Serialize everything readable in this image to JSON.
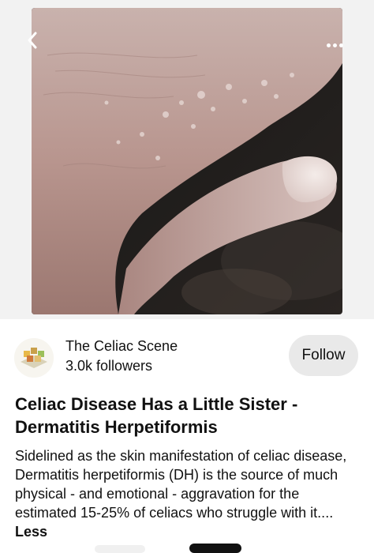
{
  "header": {
    "back_icon": "chevron-left-icon",
    "more_icon": "more-horizontal-icon"
  },
  "creator": {
    "name": "The Celiac Scene",
    "followers": "3.0k followers",
    "follow_label": "Follow"
  },
  "pin": {
    "title": "Celiac Disease Has a Little Sister - Dermatitis Herpetiformis",
    "description": "Sidelined as the skin manifestation of celiac disease, Dermatitis herpetiformis (DH) is the source of much physical - and emotional - aggravation for the estimated 15-25% of celiacs who struggle with it....",
    "less_label": "Less"
  },
  "colors": {
    "page_bg": "#ffffff",
    "follow_bg": "#e9e9e9",
    "text": "#111111"
  }
}
